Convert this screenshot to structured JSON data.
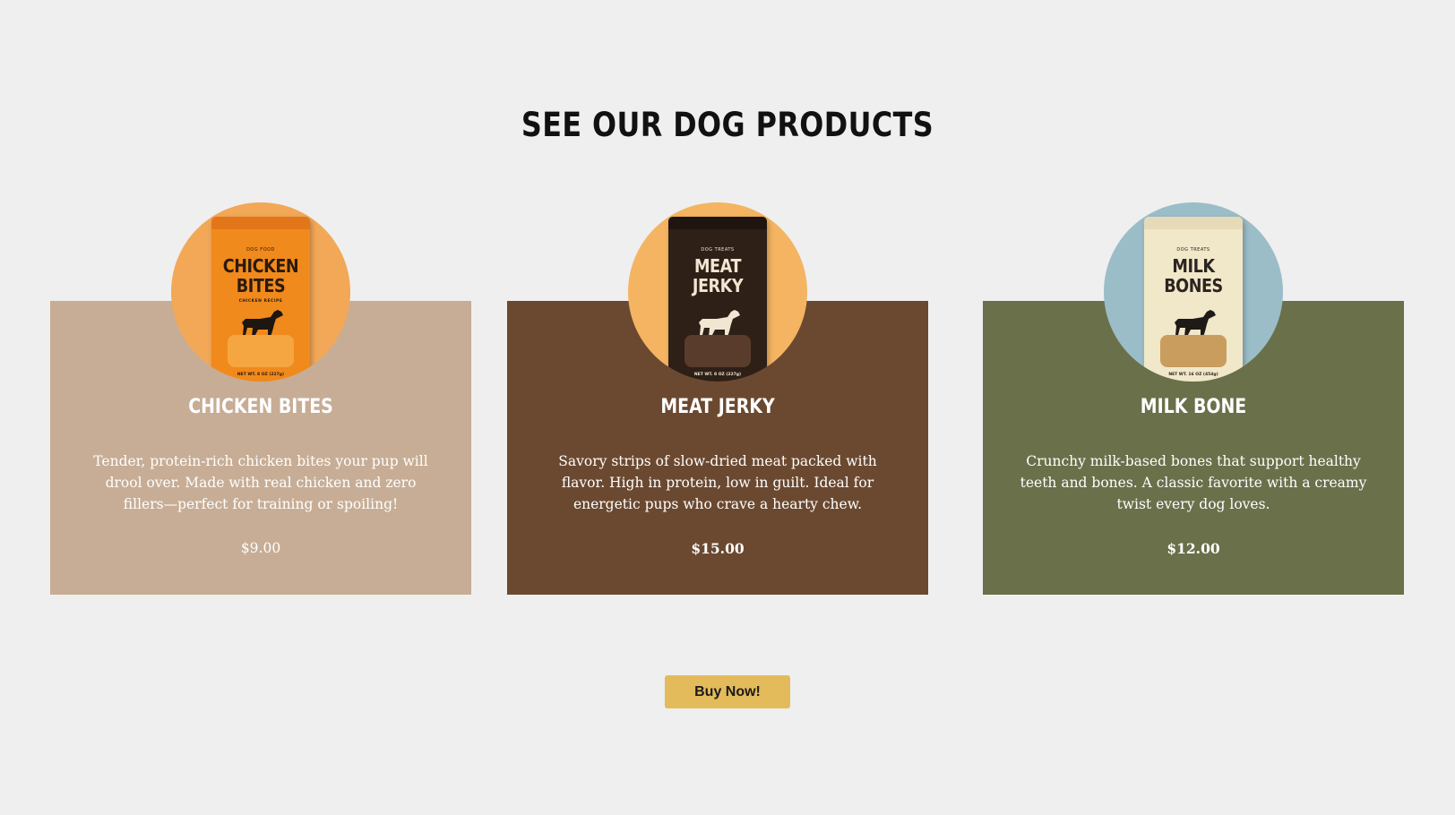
{
  "section": {
    "title": "SEE OUR DOG PRODUCTS"
  },
  "products": [
    {
      "title": "CHICKEN BITES",
      "description": "Tender, protein-rich chicken bites your pup will drool over. Made with real chicken and zero fillers—perfect for training or spoiling!",
      "price": "$9.00",
      "card_color": "#c7ad95",
      "circle_color": "#f2a857",
      "pouch": {
        "kicker": "DOG FOOD",
        "name": "CHICKEN BITES",
        "sub": "CHICKEN RECIPE",
        "weight": "NET WT. 8 OZ (227g)",
        "body_color": "#f08a1c",
        "seal_color": "#e4761a",
        "text_color": "#2b1a0e",
        "dog_color": "#1e1610",
        "window_color": "#f5a640"
      }
    },
    {
      "title": "MEAT JERKY",
      "description": "Savory strips of slow-dried meat packed with flavor. High in protein, low in guilt. Ideal for energetic pups who crave a hearty chew.",
      "price": "$15.00",
      "card_color": "#6b4930",
      "circle_color": "#f4b462",
      "pouch": {
        "kicker": "DOG TREATS",
        "name": "MEAT JERKY",
        "weight": "NET WT. 8 OZ (227g)",
        "body_color": "#2e2017",
        "seal_color": "#1f1510",
        "text_color": "#f1e6d2",
        "dog_color": "#f1e6d2",
        "window_color": "#5a3c2c"
      }
    },
    {
      "title": "MILK BONE",
      "description": "Crunchy milk-based bones that support healthy teeth and bones. A classic favorite with a creamy twist every dog loves.",
      "price": "$12.00",
      "card_color": "#6a704a",
      "circle_color": "#9bbdc8",
      "pouch": {
        "kicker": "DOG TREATS",
        "name": "MILK BONES",
        "weight": "NET WT. 16 OZ (454g)",
        "body_color": "#f1e7c9",
        "seal_color": "#e6dab8",
        "text_color": "#2b2420",
        "dog_color": "#1e1a16",
        "window_color": "#c99d5d"
      }
    }
  ],
  "cta": {
    "label": "Buy Now!"
  }
}
